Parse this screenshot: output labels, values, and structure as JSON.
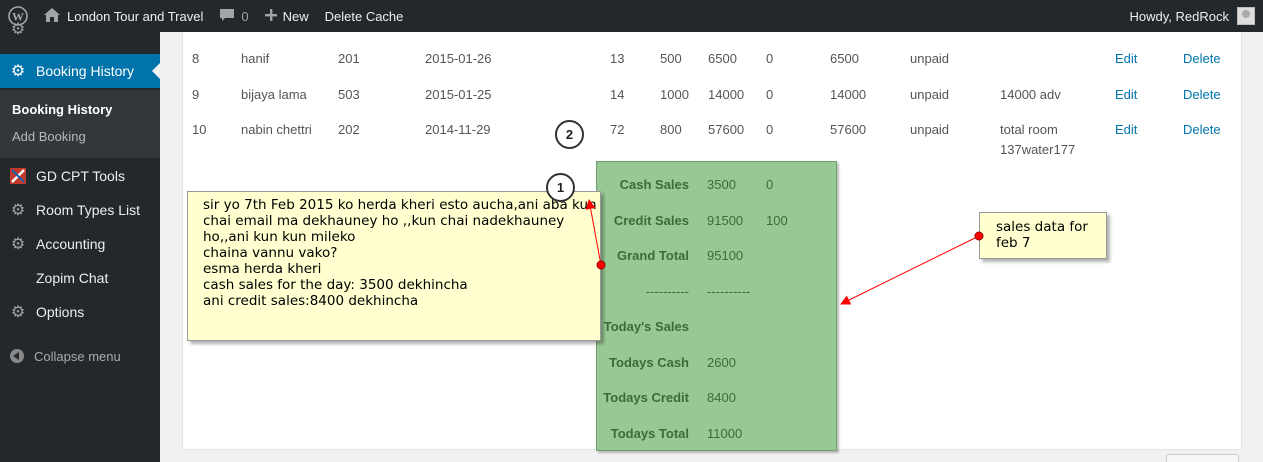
{
  "admin_bar": {
    "site_name": "London Tour and Travel",
    "comments_count": "0",
    "new_label": "New",
    "delete_cache_label": "Delete Cache",
    "greeting": "Howdy, RedRock"
  },
  "sidebar": {
    "current": "Booking History",
    "submenu": [
      "Booking History",
      "Add Booking"
    ],
    "items": [
      "GD CPT Tools",
      "Room Types List",
      "Accounting",
      "Zopim Chat",
      "Options"
    ],
    "collapse": "Collapse menu"
  },
  "table": {
    "rows": [
      {
        "id": "8",
        "name": "hanif",
        "room": "201",
        "date": "2015-01-26",
        "nights": "13",
        "rate": "500",
        "total": "6500",
        "discount": "0",
        "net": "6500",
        "status": "unpaid",
        "remarks": "",
        "remarks2": "",
        "edit": "Edit",
        "delete": "Delete"
      },
      {
        "id": "9",
        "name": "bijaya lama",
        "room": "503",
        "date": "2015-01-25",
        "nights": "14",
        "rate": "1000",
        "total": "14000",
        "discount": "0",
        "net": "14000",
        "status": "unpaid",
        "remarks": "14000 adv",
        "remarks2": "",
        "edit": "Edit",
        "delete": "Delete"
      },
      {
        "id": "10",
        "name": "nabin chettri",
        "room": "202",
        "date": "2014-11-29",
        "nights": "72",
        "rate": "800",
        "total": "57600",
        "discount": "0",
        "net": "57600",
        "status": "unpaid",
        "remarks": "total room",
        "remarks2": "137water177",
        "edit": "Edit",
        "delete": "Delete"
      }
    ]
  },
  "sales_box": {
    "rows": [
      {
        "label": "Cash Sales",
        "v1": "3500",
        "v2": "0"
      },
      {
        "label": "Credit Sales",
        "v1": "91500",
        "v2": "100"
      },
      {
        "label": "Grand Total",
        "v1": "95100",
        "v2": ""
      },
      {
        "label": "----------",
        "v1": "----------",
        "v2": ""
      },
      {
        "label": "Today's Sales",
        "v1": "",
        "v2": ""
      },
      {
        "label": "Todays Cash",
        "v1": "2600",
        "v2": ""
      },
      {
        "label": "Todays Credit",
        "v1": "8400",
        "v2": ""
      },
      {
        "label": "Todays Total",
        "v1": "11000",
        "v2": ""
      }
    ]
  },
  "callouts": {
    "one": "1",
    "two": "2",
    "note1_lines": [
      "sir yo 7th Feb 2015 ko herda kheri esto aucha,ani aba kun",
      "chai email ma dekhauney ho ,,kun chai nadekhauney",
      "ho,,ani kun kun mileko",
      "chaina vannu vako?",
      "esma herda kheri",
      "cash sales for the day: 3500 dekhincha",
      "ani credit sales:8400 dekhincha"
    ],
    "note2_lines": [
      "sales data for",
      "feb 7"
    ]
  },
  "colors": {
    "adminbar": "#23282d",
    "menu_active": "#0073aa",
    "link": "#0073aa",
    "sales_box": "#98c994",
    "note": "#ffffd0",
    "arrow": "#ff0000"
  }
}
